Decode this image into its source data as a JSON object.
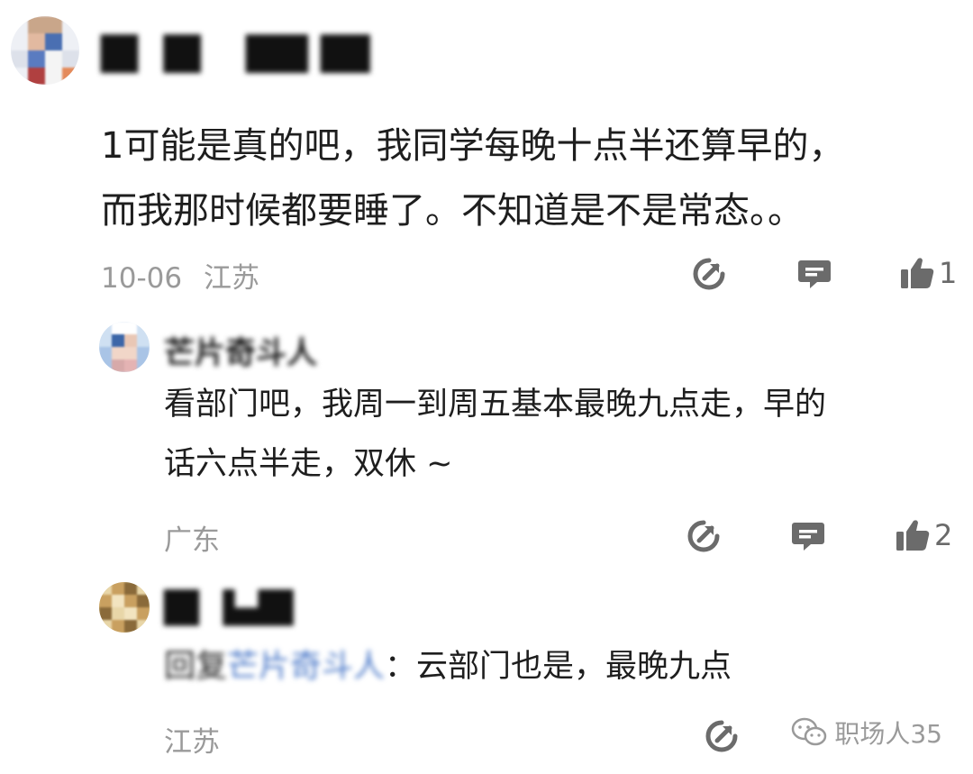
{
  "comments": [
    {
      "username": "█▌▐█ ▐██▐█▌",
      "content_line1": "1可能是真的吧，我同学每晚十点半还算早的，",
      "content_line2": "而我那时候都要睡了。不知道是不是常态。。",
      "date": "10-06",
      "location": "江苏",
      "likes": "1"
    },
    {
      "username": "芒片奇斗人",
      "content_line1": "看部门吧，我周一到周五基本最晚九点走，早的",
      "content_line2": "话六点半走，双休 ~",
      "location": "广东",
      "likes": "2"
    },
    {
      "username": "█▌▐▄█▌",
      "reply_prefix": "回复",
      "reply_to": "芒片奇斗人",
      "content": "：云部门也是，最晚九点",
      "location": "江苏"
    }
  ],
  "watermark": "职场人35",
  "icons": {
    "share": "share-icon",
    "comment": "comment-icon",
    "like": "thumbs-up-icon",
    "wechat": "wechat-icon"
  },
  "colors": {
    "icon": "#6b6b6b",
    "meta": "#9a9a9a",
    "mention": "#4a78c8"
  }
}
